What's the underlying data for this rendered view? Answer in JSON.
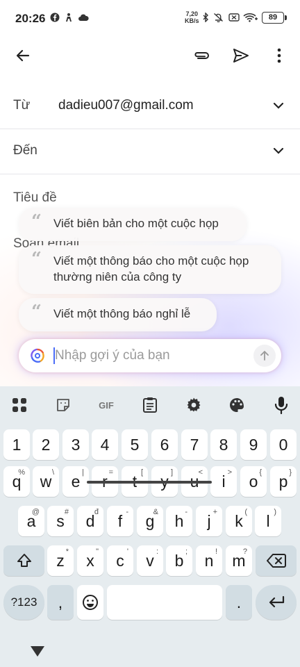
{
  "status": {
    "time": "20:26",
    "net_speed_top": "7,20",
    "net_speed_bottom": "KB/s",
    "battery": "89"
  },
  "compose": {
    "from_label": "Từ",
    "from_value": "dadieu007@gmail.com",
    "to_label": "Đến",
    "subject_placeholder": "Tiêu đề",
    "body_placeholder": "Soạn email"
  },
  "suggestions": [
    {
      "text": "Viết biên bản cho một cuộc họp"
    },
    {
      "text": "Viết một thông báo cho một cuộc họp thường niên của công ty"
    },
    {
      "text": "Viết một thông báo nghỉ lễ"
    }
  ],
  "ask": {
    "placeholder": "Nhập gợi ý của bạn"
  },
  "keyboard": {
    "toolbar": {
      "gif": "GIF"
    },
    "numbers": [
      "1",
      "2",
      "3",
      "4",
      "5",
      "6",
      "7",
      "8",
      "9",
      "0"
    ],
    "row1": [
      {
        "k": "q",
        "h": "%"
      },
      {
        "k": "w",
        "h": "\\"
      },
      {
        "k": "e",
        "h": "|"
      },
      {
        "k": "r",
        "h": "="
      },
      {
        "k": "t",
        "h": "["
      },
      {
        "k": "y",
        "h": "]"
      },
      {
        "k": "u",
        "h": "<"
      },
      {
        "k": "i",
        "h": ">"
      },
      {
        "k": "o",
        "h": "{"
      },
      {
        "k": "p",
        "h": "}"
      }
    ],
    "row2": [
      {
        "k": "a",
        "h": "@"
      },
      {
        "k": "s",
        "h": "#"
      },
      {
        "k": "d",
        "h": "đ"
      },
      {
        "k": "f",
        "h": "-"
      },
      {
        "k": "g",
        "h": "&"
      },
      {
        "k": "h",
        "h": "-"
      },
      {
        "k": "j",
        "h": "+"
      },
      {
        "k": "k",
        "h": "("
      },
      {
        "k": "l",
        "h": ")"
      }
    ],
    "row3": [
      {
        "k": "z",
        "h": "*"
      },
      {
        "k": "x",
        "h": "\""
      },
      {
        "k": "c",
        "h": "'"
      },
      {
        "k": "v",
        "h": ":"
      },
      {
        "k": "b",
        "h": ";"
      },
      {
        "k": "n",
        "h": "!"
      },
      {
        "k": "m",
        "h": "?"
      }
    ],
    "symbols_label": "?123",
    "comma": ",",
    "period": "."
  }
}
